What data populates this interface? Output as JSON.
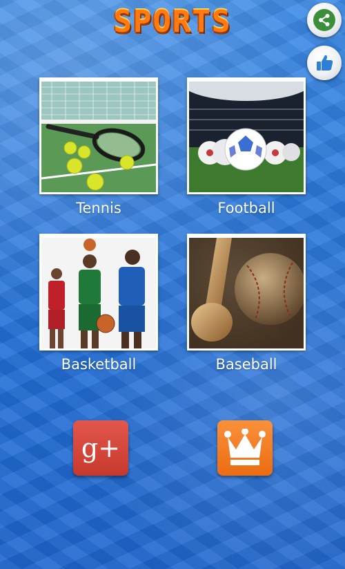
{
  "app": {
    "title": "SPORTS"
  },
  "toolbar": {
    "share_icon": "share-icon",
    "like_icon": "thumbs-up-icon"
  },
  "categories": [
    {
      "label": "Tennis",
      "icon": "tennis-image"
    },
    {
      "label": "Football",
      "icon": "football-image"
    },
    {
      "label": "Basketball",
      "icon": "basketball-image"
    },
    {
      "label": "Baseball",
      "icon": "baseball-image"
    }
  ],
  "bottom": {
    "gplus_text": "g+",
    "gplus_icon": "google-plus-icon",
    "crown_icon": "crown-icon"
  },
  "colors": {
    "background": "#2472d9",
    "title": "#ff7a12",
    "gplus": "#d6453a",
    "crown": "#f27d1f",
    "share": "#3b8f3b"
  }
}
